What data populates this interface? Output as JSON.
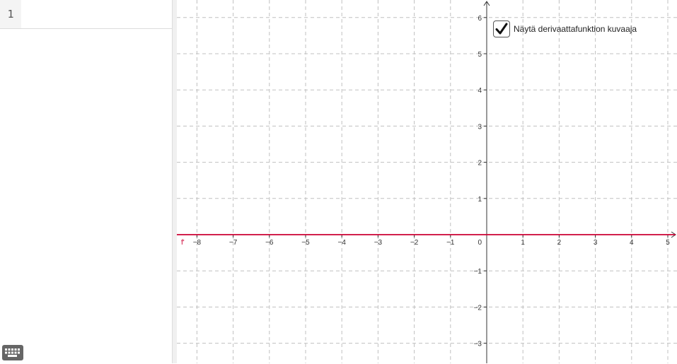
{
  "algebra": {
    "row_number": "1",
    "input_value": "",
    "input_placeholder": ""
  },
  "graphics": {
    "checkbox": {
      "label": "Näytä derivaattafunktion kuvaaja",
      "checked": true
    },
    "function_label": "f'",
    "colors": {
      "function": "#cc0033",
      "grid": "#c0c0c0",
      "axes": "#333333"
    },
    "axes": {
      "x_ticks": [
        -8,
        -7,
        -6,
        -5,
        -4,
        -3,
        -2,
        -1,
        1,
        2,
        3,
        4,
        5
      ],
      "y_ticks": [
        -3,
        -2,
        -1,
        1,
        2,
        3,
        4,
        5,
        6
      ],
      "origin_label": "0",
      "xlim": [
        -8.5,
        5.3
      ],
      "ylim": [
        -3.5,
        6.5
      ]
    }
  },
  "icons": {
    "keyboard": "keyboard-icon",
    "check": "checkmark-icon"
  }
}
